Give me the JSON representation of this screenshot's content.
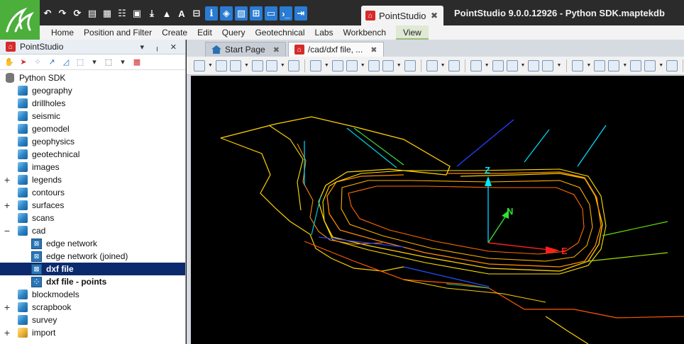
{
  "app": {
    "title": "PointStudio 9.0.0.12926 - Python SDK.maptekdb",
    "document_tab": "PointStudio",
    "colors": {
      "logo": "#4caf3c",
      "titlebar": "#2b2b2b",
      "selection": "#0b2a6e"
    }
  },
  "quick_access": {
    "icons": [
      "undo-icon",
      "redo-icon",
      "refresh-icon",
      "report-icon",
      "table-icon",
      "sheet-icon",
      "sheet2-icon",
      "download-icon",
      "terrain-icon",
      "text-icon",
      "hierarchy-icon",
      "info-icon",
      "cube-icon",
      "document-icon",
      "windows-icon",
      "monitor-icon",
      "console-icon",
      "exit-icon"
    ],
    "text_glyph": "A"
  },
  "ribbon": {
    "items": [
      "Home",
      "Position and Filter",
      "Create",
      "Edit",
      "Query",
      "Geotechnical",
      "Labs",
      "Workbench",
      "View"
    ],
    "active": "View"
  },
  "left_panel": {
    "title": "PointStudio",
    "pin_controls": "▾ ╷ ✕"
  },
  "tree": {
    "root": "Python SDK",
    "items": [
      {
        "label": "geography",
        "icon": "cube-icon",
        "expandable": false,
        "indent": 1
      },
      {
        "label": "drillholes",
        "icon": "cube-icon",
        "expandable": false,
        "indent": 1
      },
      {
        "label": "seismic",
        "icon": "cube-icon",
        "expandable": false,
        "indent": 1
      },
      {
        "label": "geomodel",
        "icon": "cube-icon",
        "expandable": false,
        "indent": 1
      },
      {
        "label": "geophysics",
        "icon": "cube-icon",
        "expandable": false,
        "indent": 1
      },
      {
        "label": "geotechnical",
        "icon": "cube-icon",
        "expandable": false,
        "indent": 1
      },
      {
        "label": "images",
        "icon": "cube-icon",
        "expandable": false,
        "indent": 1
      },
      {
        "label": "legends",
        "icon": "cube-icon",
        "expandable": true,
        "indent": 1
      },
      {
        "label": "contours",
        "icon": "cube-icon",
        "expandable": false,
        "indent": 1
      },
      {
        "label": "surfaces",
        "icon": "cube-icon",
        "expandable": true,
        "indent": 1
      },
      {
        "label": "scans",
        "icon": "cube-icon",
        "expandable": false,
        "indent": 1
      },
      {
        "label": "cad",
        "icon": "cube-icon",
        "expandable": true,
        "expanded": true,
        "indent": 1
      },
      {
        "label": "edge network",
        "icon": "cad-icon",
        "expandable": false,
        "indent": 2
      },
      {
        "label": "edge network (joined)",
        "icon": "cad-icon",
        "expandable": false,
        "indent": 2
      },
      {
        "label": "dxf file",
        "icon": "cad-icon",
        "expandable": false,
        "indent": 2,
        "selected": true
      },
      {
        "label": "dxf file - points",
        "icon": "points-icon",
        "expandable": false,
        "indent": 2,
        "bold": true
      },
      {
        "label": "blockmodels",
        "icon": "cube-icon",
        "expandable": false,
        "indent": 1
      },
      {
        "label": "scrapbook",
        "icon": "cube-icon",
        "expandable": true,
        "indent": 1
      },
      {
        "label": "survey",
        "icon": "cube-icon",
        "expandable": false,
        "indent": 1
      },
      {
        "label": "import",
        "icon": "folder-cube-icon",
        "expandable": true,
        "indent": 1
      }
    ]
  },
  "view_tabs": [
    {
      "label": "Start Page",
      "close": "✖",
      "icon": "home-icon"
    },
    {
      "label": "/cad/dxf file, ...",
      "close": "✖",
      "icon": "pointstudio-icon",
      "active": true
    }
  ],
  "viewport": {
    "axes": {
      "z": "Z",
      "n": "N",
      "e": "E"
    },
    "background": "#000000"
  }
}
